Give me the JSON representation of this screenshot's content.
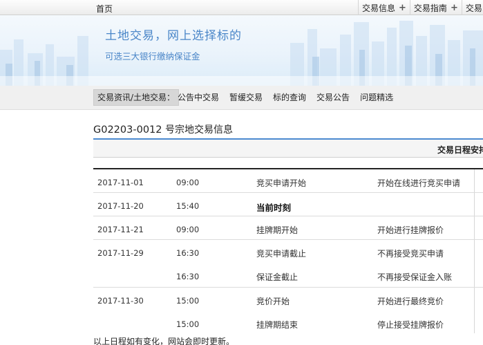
{
  "topnav": {
    "home": "首页",
    "items": [
      {
        "label": "交易信息",
        "icon": "plus-icon"
      },
      {
        "label": "交易指南",
        "icon": "plus-icon"
      },
      {
        "label": "交易系"
      }
    ]
  },
  "banner": {
    "title": "土地交易，网上选择标的",
    "subtitle": "可选三大银行缴纳保证金"
  },
  "subnav": {
    "crumb": "交易资讯/土地交易：",
    "items": [
      "公告中交易",
      "暂缓交易",
      "标的查询",
      "交易公告",
      "问题精选"
    ]
  },
  "info": {
    "code": "G02203-0012",
    "title_suffix": "号宗地交易信息",
    "schedule_header": "交易日程安排"
  },
  "schedule": [
    {
      "date": "2017-11-01",
      "entries": [
        {
          "time": "09:00",
          "event": "竞买申请开始",
          "note": "开始在线进行竞买申请"
        }
      ]
    },
    {
      "date": "2017-11-20",
      "entries": [
        {
          "time": "15:40",
          "event": "当前时刻",
          "note": "",
          "bold": true
        }
      ]
    },
    {
      "date": "2017-11-21",
      "entries": [
        {
          "time": "09:00",
          "event": "挂牌期开始",
          "note": "开始进行挂牌报价"
        }
      ]
    },
    {
      "date": "2017-11-29",
      "entries": [
        {
          "time": "16:30",
          "event": "竞买申请截止",
          "note": "不再接受竞买申请"
        },
        {
          "time": "16:30",
          "event": "保证金截止",
          "note": "不再接受保证金入账"
        }
      ]
    },
    {
      "date": "2017-11-30",
      "entries": [
        {
          "time": "15:00",
          "event": "竞价开始",
          "note": "开始进行最终竞价"
        },
        {
          "time": "15:00",
          "event": "挂牌期结束",
          "note": "停止接受挂牌报价"
        }
      ]
    }
  ],
  "footer_note": "以上日程如有变化，网站会即时更新。",
  "colors": {
    "accent": "#4b8ad0",
    "banner_text": "#4a86c8"
  }
}
